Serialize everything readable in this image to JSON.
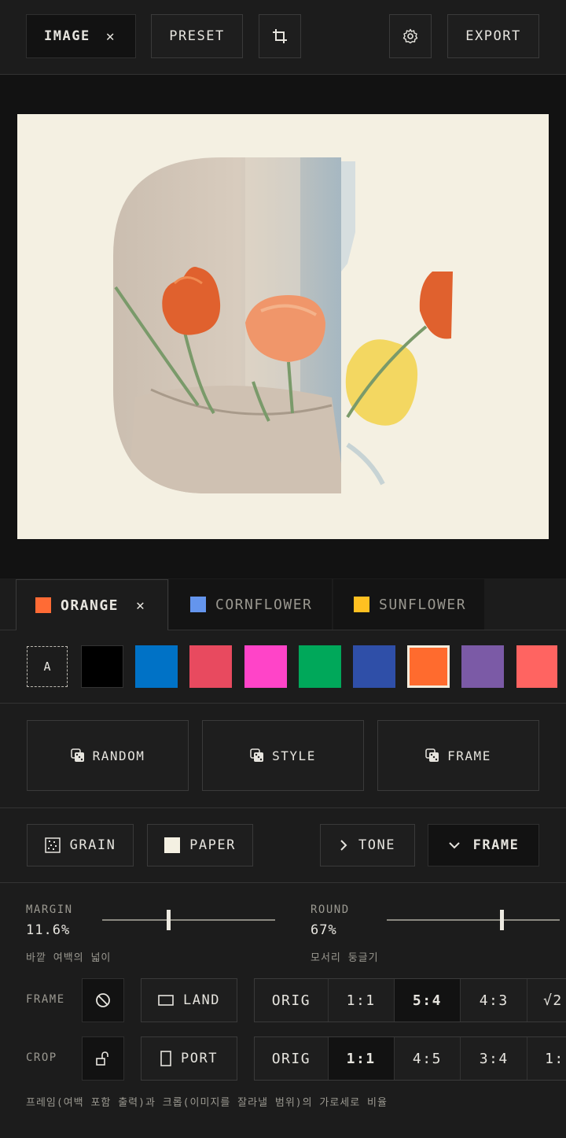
{
  "header": {
    "image_label": "IMAGE",
    "preset_label": "PRESET",
    "export_label": "EXPORT",
    "close_glyph": "✕"
  },
  "tabs": [
    {
      "label": "ORANGE",
      "color": "#ff6b35",
      "active": true
    },
    {
      "label": "CORNFLOWER",
      "color": "#6495ed",
      "active": false
    },
    {
      "label": "SUNFLOWER",
      "color": "#ffc021",
      "active": false
    }
  ],
  "palette": {
    "auto_label": "A",
    "colors": [
      "#000000",
      "#0072c6",
      "#e84a5f",
      "#ff44c8",
      "#00a85a",
      "#2f4fa8",
      "#ff6b2e",
      "#7b5aa6",
      "#ff6461"
    ],
    "selected_index": 6
  },
  "actions": {
    "random": "RANDOM",
    "style": "STYLE",
    "frame": "FRAME"
  },
  "toggles": {
    "grain": "GRAIN",
    "paper": "PAPER",
    "tone": "TONE",
    "frame": "FRAME"
  },
  "sliders": {
    "margin": {
      "label": "MARGIN",
      "value": "11.6%",
      "desc": "바깥 여백의 넓이",
      "fraction": 0.39
    },
    "round": {
      "label": "ROUND",
      "value": "67%",
      "desc": "모서리 둥글기",
      "fraction": 0.67
    }
  },
  "frame_row": {
    "label": "FRAME",
    "orientation": "LAND",
    "ratios": [
      "ORIG",
      "1:1",
      "5:4",
      "4:3",
      "√2"
    ],
    "selected": 2
  },
  "crop_row": {
    "label": "CROP",
    "orientation": "PORT",
    "ratios": [
      "ORIG",
      "1:1",
      "4:5",
      "3:4",
      "1:"
    ],
    "selected": 1
  },
  "footer_note": "프레임(여백 포함 출력)과 크롭(이미지를 잘라낼 범위)의 가로세로 비율",
  "colors": {
    "background": "#1c1c1c",
    "preview_bg": "#121212",
    "paper": "#f4f0e2"
  }
}
